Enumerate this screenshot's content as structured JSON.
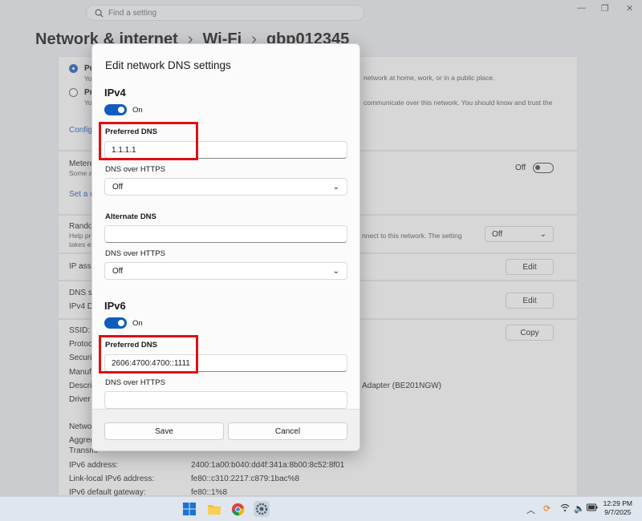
{
  "search": {
    "placeholder": "Find a setting"
  },
  "breadcrumb": {
    "part1": "Network & internet",
    "part2": "Wi-Fi",
    "part3": "gbp012345",
    "sep": "›"
  },
  "background": {
    "public_trunc": "Pu",
    "public_desc_trunc": "Yo",
    "public_desc_right": "network at home, work, or in a public place.",
    "private_trunc": "Pr",
    "private_desc_trunc": "Yo",
    "private_desc_right": "communicate over this network. You should know and trust the",
    "config_link": "Config",
    "metered_trunc": "Metere",
    "metered_desc": "Some a",
    "metered_state": "Off",
    "set_link": "Set a d",
    "random_trunc": "Random",
    "random_desc1": "Help pr",
    "random_desc2": "takes ef",
    "random_right": "nnect to this network. The setting",
    "random_value": "Off",
    "ip_assign": "IP assig",
    "dns_se": "DNS se",
    "ipv4_d": "IPv4 D",
    "edit1": "Edit",
    "edit2": "Edit",
    "copy": "Copy",
    "ssid": "SSID:",
    "protocol": "Protoc",
    "security": "Securit",
    "manufacturer": "Manufa",
    "description": "Descrip",
    "desc_value": "Adapter (BE201NGW)",
    "driver": "Driver",
    "network": "Netwo",
    "aggregate": "Aggreg",
    "transmit": "Transmi",
    "ipv6_address_label": "IPv6 address:",
    "ipv6_address_value": "2400:1a00:b040:dd4f:341a:8b00:8c52:8f01",
    "linklocal_label": "Link-local IPv6 address:",
    "linklocal_value": "fe80::c310:2217:c879:1bac%8",
    "gateway_label": "IPv6 default gateway:",
    "gateway_value": "fe80::1%8"
  },
  "dialog": {
    "title": "Edit network DNS settings",
    "ipv4": {
      "heading": "IPv4",
      "toggle_label": "On",
      "preferred_label": "Preferred DNS",
      "preferred_value": "1.1.1.1",
      "doh_label": "DNS over HTTPS",
      "doh_value": "Off",
      "alternate_label": "Alternate DNS",
      "alternate_value": "",
      "doh2_label": "DNS over HTTPS",
      "doh2_value": "Off"
    },
    "ipv6": {
      "heading": "IPv6",
      "toggle_label": "On",
      "preferred_label": "Preferred DNS",
      "preferred_value": "2606:4700:4700::1111",
      "doh_label": "DNS over HTTPS"
    },
    "save": "Save",
    "cancel": "Cancel"
  },
  "taskbar": {
    "time": "12:29 PM",
    "date": "9/7/2025"
  },
  "colors": {
    "accent": "#0f5cc0",
    "highlight": "#e01010"
  }
}
